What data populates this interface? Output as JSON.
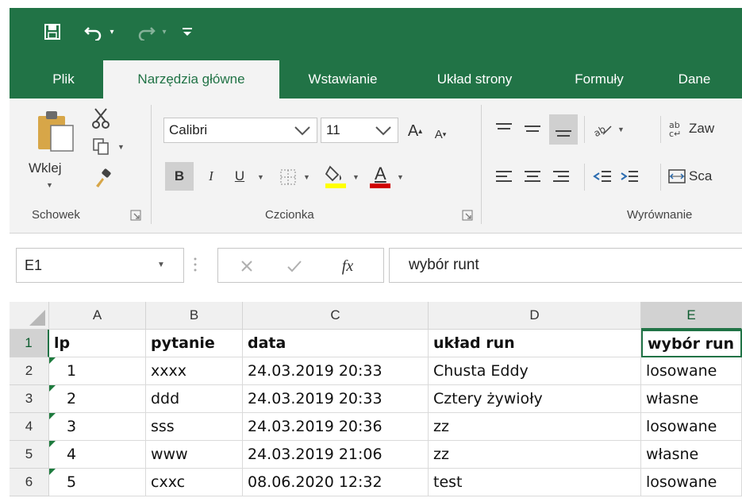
{
  "qat": {
    "icons": [
      "save-icon",
      "undo-icon",
      "redo-icon",
      "customize-icon"
    ]
  },
  "tabs": [
    "Plik",
    "Narzędzia główne",
    "Wstawianie",
    "Układ strony",
    "Formuły",
    "Dane"
  ],
  "active_tab": "Narzędzia główne",
  "ribbon": {
    "clipboard": {
      "paste_label": "Wklej",
      "group_label": "Schowek"
    },
    "font": {
      "font_name": "Calibri",
      "font_size": "11",
      "bold": "B",
      "italic": "I",
      "underline": "U",
      "font_color_letter": "A",
      "group_label": "Czcionka"
    },
    "alignment": {
      "wrap_label": "Zaw",
      "merge_label": "Sca",
      "group_label": "Wyrównanie"
    },
    "colors": {
      "fill": "#ffff00",
      "font": "#d00000",
      "accent": "#217346"
    }
  },
  "formula_bar": {
    "name_box": "E1",
    "fx": "fx",
    "formula": "wybór runt"
  },
  "grid": {
    "columns": [
      "A",
      "B",
      "C",
      "D",
      "E"
    ],
    "selected_column": "E",
    "rows": [
      {
        "num": "1",
        "cells": [
          "lp",
          "pytanie",
          "data",
          "układ run",
          "wybór run"
        ]
      },
      {
        "num": "2",
        "cells": [
          "1",
          "xxxx",
          "24.03.2019  20:33",
          "Chusta Eddy",
          "losowane"
        ]
      },
      {
        "num": "3",
        "cells": [
          "2",
          "ddd",
          "24.03.2019  20:33",
          "Cztery żywioły",
          "własne"
        ]
      },
      {
        "num": "4",
        "cells": [
          "3",
          "sss",
          "24.03.2019  20:36",
          "zz",
          "losowane"
        ]
      },
      {
        "num": "5",
        "cells": [
          "4",
          "www",
          "24.03.2019  21:06",
          "zz",
          "własne"
        ]
      },
      {
        "num": "6",
        "cells": [
          "5",
          "cxxc",
          "08.06.2020  12:32",
          "test",
          "losowane"
        ]
      }
    ]
  }
}
